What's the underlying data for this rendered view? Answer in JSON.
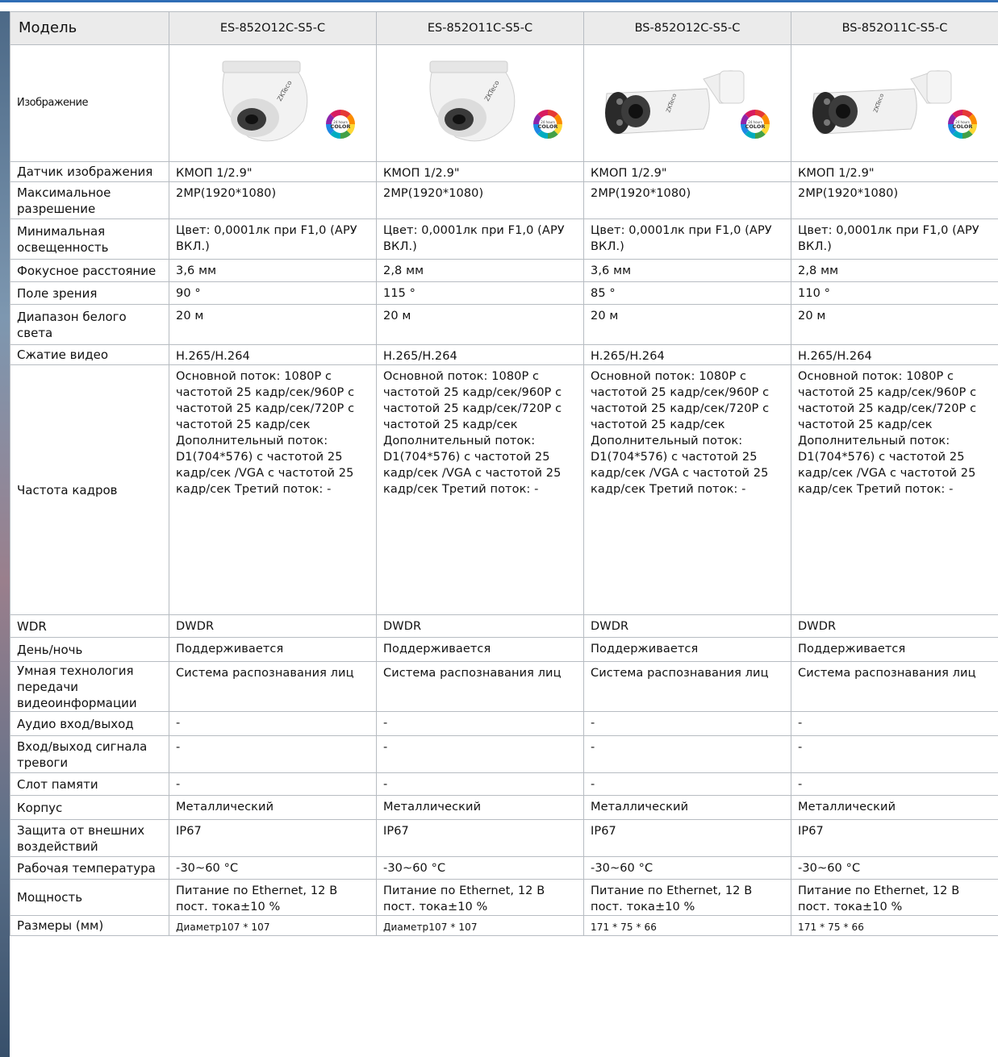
{
  "header": {
    "model_label": "Модель",
    "models": [
      "ES-852O12C-S5-C",
      "ES-852O11C-S5-C",
      "BS-852O12C-S5-C",
      "BS-852O11C-S5-C"
    ]
  },
  "image_row": {
    "label": "Изображение",
    "camera_types": [
      "dome-camera",
      "dome-camera",
      "bullet-camera",
      "bullet-camera"
    ],
    "badge_text": "COLOR",
    "badge_small": "24 hours"
  },
  "specs": [
    {
      "label": "Датчик изображения",
      "values": [
        "КМОП 1/2.9\"",
        "КМОП 1/2.9\"",
        "КМОП 1/2.9\"",
        "КМОП 1/2.9\""
      ]
    },
    {
      "label": "Максимальное разрешение",
      "values": [
        "2MP(1920*1080)",
        "2MP(1920*1080)",
        "2MP(1920*1080)",
        "2MP(1920*1080)"
      ]
    },
    {
      "label": "Минимальная освещенность",
      "values": [
        "Цвет: 0,0001лк при F1,0 (АРУ ВКЛ.)",
        "Цвет: 0,0001лк при F1,0 (АРУ ВКЛ.)",
        "Цвет: 0,0001лк при F1,0 (АРУ ВКЛ.)",
        "Цвет: 0,0001лк при F1,0 (АРУ ВКЛ.)"
      ]
    },
    {
      "label": "Фокусное расстояние",
      "values": [
        "3,6 мм",
        "2,8 мм",
        "3,6 мм",
        "2,8 мм"
      ]
    },
    {
      "label": "Поле зрения",
      "values": [
        "90 °",
        "115 °",
        "85 °",
        "110 °"
      ]
    },
    {
      "label": "Диапазон белого света",
      "values": [
        "20 м",
        "20 м",
        "20 м",
        "20 м"
      ]
    },
    {
      "label": "Сжатие видео",
      "values": [
        "H.265/H.264",
        "H.265/H.264",
        "H.265/H.264",
        "H.265/H.264"
      ]
    },
    {
      "label": "Частота кадров",
      "values": [
        "Основной поток: 1080P с частотой 25 кадр/сек/960P с частотой 25 кадр/сек/720P с частотой 25 кадр/сек Дополнительный поток: D1(704*576) с частотой 25 кадр/сек /VGA с частотой 25 кадр/сек Третий поток: -",
        "Основной поток: 1080P с частотой 25 кадр/сек/960P с частотой 25 кадр/сек/720P с частотой 25 кадр/сек Дополнительный поток: D1(704*576) с частотой 25 кадр/сек /VGA с частотой 25 кадр/сек Третий поток: -",
        "Основной поток: 1080P с частотой 25 кадр/сек/960P с частотой 25 кадр/сек/720P с частотой 25 кадр/сек Дополнительный поток: D1(704*576) с частотой 25 кадр/сек /VGA с частотой 25 кадр/сек Третий поток: -",
        "Основной поток: 1080P с частотой 25 кадр/сек/960P с частотой 25 кадр/сек/720P с частотой 25 кадр/сек Дополнительный поток: D1(704*576) с частотой 25 кадр/сек /VGA с частотой 25 кадр/сек Третий поток: -"
      ]
    },
    {
      "label": "WDR",
      "values": [
        "DWDR",
        "DWDR",
        "DWDR",
        "DWDR"
      ]
    },
    {
      "label": "День/ночь",
      "values": [
        "Поддерживается",
        "Поддерживается",
        "Поддерживается",
        "Поддерживается"
      ]
    },
    {
      "label": "Умная технология передачи видеоинформации",
      "values": [
        "Система распознавания лиц",
        "Система распознавания лиц",
        "Система распознавания лиц",
        "Система распознавания лиц"
      ]
    },
    {
      "label": "Аудио вход/выход",
      "values": [
        "-",
        "-",
        "-",
        "-"
      ]
    },
    {
      "label": "Вход/выход сигнала тревоги",
      "values": [
        "-",
        "-",
        "-",
        "-"
      ]
    },
    {
      "label": "Слот памяти",
      "values": [
        "-",
        "-",
        "-",
        "-"
      ]
    },
    {
      "label": "Корпус",
      "values": [
        "Металлический",
        "Металлический",
        "Металлический",
        "Металлический"
      ]
    },
    {
      "label": "Защита от внешних воздействий",
      "values": [
        "IP67",
        "IP67",
        "IP67",
        "IP67"
      ]
    },
    {
      "label": "Рабочая температура",
      "values": [
        "-30~60 °C",
        "-30~60 °C",
        "-30~60 °C",
        "-30~60 °C"
      ]
    },
    {
      "label": "Мощность",
      "values": [
        "Питание по Ethernet, 12 В пост. тока±10 %",
        "Питание по Ethernet, 12 В пост. тока±10 %",
        "Питание по Ethernet, 12 В пост. тока±10 %",
        "Питание по Ethernet, 12 В пост. тока±10 %"
      ]
    },
    {
      "label": "Размеры (мм)",
      "values": [
        "Диаметр107 * 107",
        "Диаметр107 * 107",
        "171 * 75 * 66",
        "171 * 75 * 66"
      ]
    }
  ]
}
